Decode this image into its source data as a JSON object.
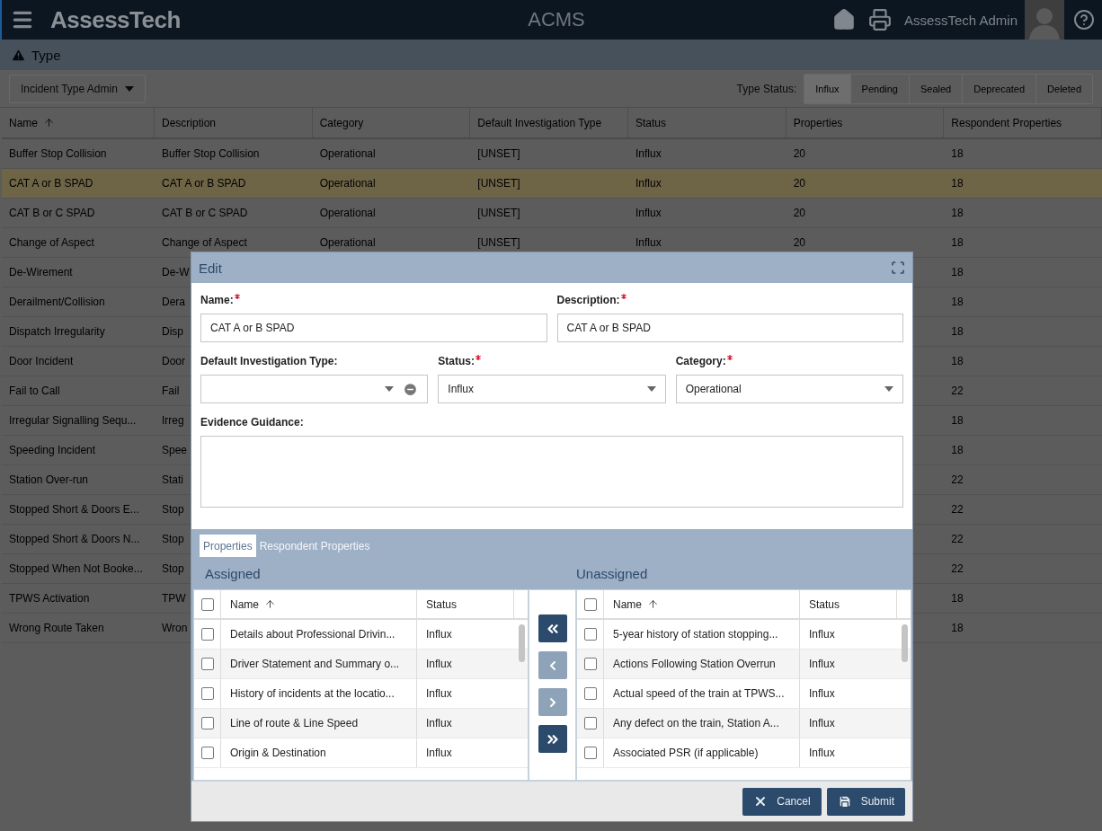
{
  "header": {
    "logo": "AssessTech",
    "title": "ACMS",
    "user": "AssessTech Admin"
  },
  "breadcrumb": {
    "title": "Type"
  },
  "toolbar": {
    "menu": "Incident Type Admin",
    "status_label": "Type Status:",
    "status_filters": [
      {
        "label": "Influx",
        "selected": true
      },
      {
        "label": "Pending",
        "selected": false
      },
      {
        "label": "Sealed",
        "selected": false
      },
      {
        "label": "Deprecated",
        "selected": false
      },
      {
        "label": "Deleted",
        "selected": false
      }
    ]
  },
  "table": {
    "columns": [
      {
        "label": "Name",
        "sorted": true
      },
      {
        "label": "Description",
        "sorted": false
      },
      {
        "label": "Category",
        "sorted": false
      },
      {
        "label": "Default Investigation Type",
        "sorted": false
      },
      {
        "label": "Status",
        "sorted": false
      },
      {
        "label": "Properties",
        "sorted": false
      },
      {
        "label": "Respondent Properties",
        "sorted": false
      }
    ],
    "rows": [
      {
        "selected": false,
        "cells": [
          "Buffer Stop Collision",
          "Buffer Stop Collision",
          "Operational",
          "[UNSET]",
          "Influx",
          "20",
          "18"
        ]
      },
      {
        "selected": true,
        "cells": [
          "CAT A or B SPAD",
          "CAT A or B SPAD",
          "Operational",
          "[UNSET]",
          "Influx",
          "20",
          "18"
        ]
      },
      {
        "selected": false,
        "cells": [
          "CAT B or C SPAD",
          "CAT B or C SPAD",
          "Operational",
          "[UNSET]",
          "Influx",
          "20",
          "18"
        ]
      },
      {
        "selected": false,
        "cells": [
          "Change of Aspect",
          "Change of Aspect",
          "Operational",
          "[UNSET]",
          "Influx",
          "20",
          "18"
        ]
      },
      {
        "selected": false,
        "name": "De-Wirement",
        "description": "De-W",
        "respondent_properties": "18"
      },
      {
        "selected": false,
        "name": "Derailment/Collision",
        "description": "Dera",
        "respondent_properties": "18"
      },
      {
        "selected": false,
        "name": "Dispatch Irregularity",
        "description": "Disp",
        "respondent_properties": "18"
      },
      {
        "selected": false,
        "name": "Door Incident",
        "description": "Door",
        "respondent_properties": "18"
      },
      {
        "selected": false,
        "name": "Fail to Call",
        "description": "Fail",
        "respondent_properties": "22"
      },
      {
        "selected": false,
        "name": "Irregular Signalling Sequ...",
        "description": "Irreg",
        "respondent_properties": "18"
      },
      {
        "selected": false,
        "name": "Speeding Incident",
        "description": "Spee",
        "respondent_properties": "18"
      },
      {
        "selected": false,
        "name": "Station Over-run",
        "description": "Stati",
        "respondent_properties": "22"
      },
      {
        "selected": false,
        "name": "Stopped Short & Doors E...",
        "description": "Stop",
        "respondent_properties": "22"
      },
      {
        "selected": false,
        "name": "Stopped Short & Doors N...",
        "description": "Stop",
        "respondent_properties": "22"
      },
      {
        "selected": false,
        "name": "Stopped When Not Booke...",
        "description": "Stop",
        "respondent_properties": "22"
      },
      {
        "selected": false,
        "name": "TPWS Activation",
        "description": "TPW",
        "respondent_properties": "18"
      },
      {
        "selected": false,
        "name": "Wrong Route Taken",
        "description": "Wron",
        "respondent_properties": "18"
      }
    ]
  },
  "modal": {
    "title": "Edit",
    "form_rows": [
      [
        {
          "kind": "text",
          "label": "Name:",
          "required": true,
          "value": "CAT A or B SPAD"
        },
        {
          "kind": "text",
          "label": "Description:",
          "required": true,
          "value": "CAT A or B SPAD"
        }
      ],
      [
        {
          "kind": "clearable-select",
          "label": "Default Investigation Type:",
          "required": false
        },
        {
          "kind": "select",
          "label": "Status:",
          "required": true,
          "value": "Influx"
        },
        {
          "kind": "select",
          "label": "Category:",
          "required": true,
          "value": "Operational"
        }
      ],
      [
        {
          "kind": "textarea",
          "label": "Evidence Guidance:",
          "required": false
        }
      ]
    ],
    "tabs": [
      {
        "label": "Properties",
        "selected": true
      },
      {
        "label": "Respondent Properties",
        "selected": false
      }
    ],
    "lists": [
      {
        "title": "Assigned",
        "all_checked": false,
        "columns": [
          {
            "label": "Name",
            "sorted": true
          },
          {
            "label": "Status",
            "sorted": false
          }
        ],
        "rows": [
          {
            "name": "Details about Professional Drivin...",
            "status": "Influx",
            "checked": false
          },
          {
            "name": "Driver Statement and Summary o...",
            "status": "Influx",
            "checked": false
          },
          {
            "name": "History of incidents at the locatio...",
            "status": "Influx",
            "checked": false
          },
          {
            "name": "Line of route & Line Speed",
            "status": "Influx",
            "checked": false
          },
          {
            "name": "Origin & Destination",
            "status": "Influx",
            "checked": false
          }
        ]
      },
      {
        "title": "Unassigned",
        "all_checked": false,
        "columns": [
          {
            "label": "Name",
            "sorted": true
          },
          {
            "label": "Status",
            "sorted": false
          }
        ],
        "rows": [
          {
            "name": "5-year history of station stopping...",
            "status": "Influx",
            "checked": false
          },
          {
            "name": "Actions Following Station Overrun",
            "status": "Influx",
            "checked": false
          },
          {
            "name": "Actual speed of the train at TPWS...",
            "status": "Influx",
            "checked": false
          },
          {
            "name": "Any defect on the train, Station A...",
            "status": "Influx",
            "checked": false
          },
          {
            "name": "Associated PSR (if applicable)",
            "status": "Influx",
            "checked": false
          }
        ]
      }
    ],
    "transfer_buttons": [
      {
        "kind": "all-left",
        "disabled": false
      },
      {
        "kind": "left",
        "disabled": true
      },
      {
        "kind": "right",
        "disabled": true
      },
      {
        "kind": "all-right",
        "disabled": false
      }
    ],
    "buttons": [
      {
        "kind": "cancel",
        "label": "Cancel"
      },
      {
        "kind": "submit",
        "label": "Submit"
      }
    ]
  }
}
